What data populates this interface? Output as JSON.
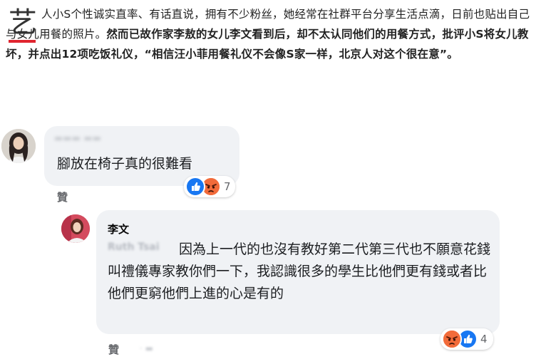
{
  "article": {
    "dropcap": "艺",
    "text_normal": "人小S个性诚实直率、有话直说，拥有不少粉丝，她经常在社群平台分享生活点滴，日前也贴出自己与女儿用餐的照片。",
    "text_bold": "然而已故作家李敖的女儿李文看到后，却不太认同他们的用餐方式，批评小S将女儿教坏，并点出12项吃饭礼仪，“相信汪小菲用餐礼仪不会像S家一样，北京人对这个很在意”。"
  },
  "comment": {
    "text": "腳放在椅子真的很難看",
    "reaction_count": "7",
    "like_label": "贊",
    "reactions": [
      "like-icon",
      "angry-icon"
    ],
    "colors": {
      "like": "#1877f2",
      "angry": "#f26b3a"
    }
  },
  "reply": {
    "author": "李文",
    "text": "因為上一代的也沒有教好第二代第三代也不願意花錢叫禮儀專家教你們一下，我認識很多的學生比他們更有錢或者比他們更窮他們上進的心是有的",
    "reaction_count": "4",
    "like_label": "贊",
    "reactions": [
      "angry-icon",
      "like-icon"
    ]
  }
}
